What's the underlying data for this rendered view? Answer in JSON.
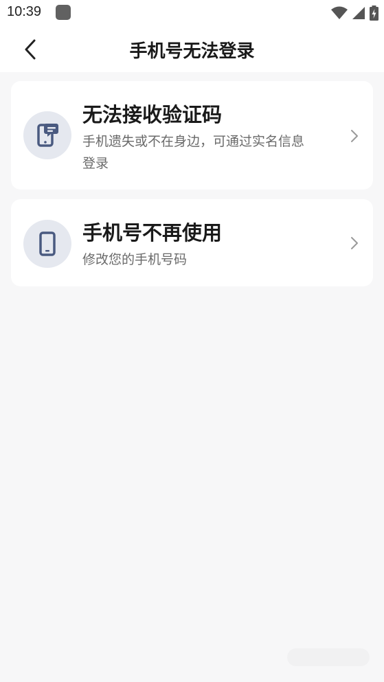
{
  "status_bar": {
    "time": "10:39"
  },
  "header": {
    "title": "手机号无法登录"
  },
  "options": [
    {
      "title": "无法接收验证码",
      "description": "手机遗失或不在身边，可通过实名信息登录"
    },
    {
      "title": "手机号不再使用",
      "description": "修改您的手机号码"
    }
  ],
  "colors": {
    "background": "#f7f7f8",
    "card": "#ffffff",
    "icon_circle": "#e5e8ef",
    "icon": "#4a5a80",
    "secondary_text": "#6a6a6a"
  }
}
